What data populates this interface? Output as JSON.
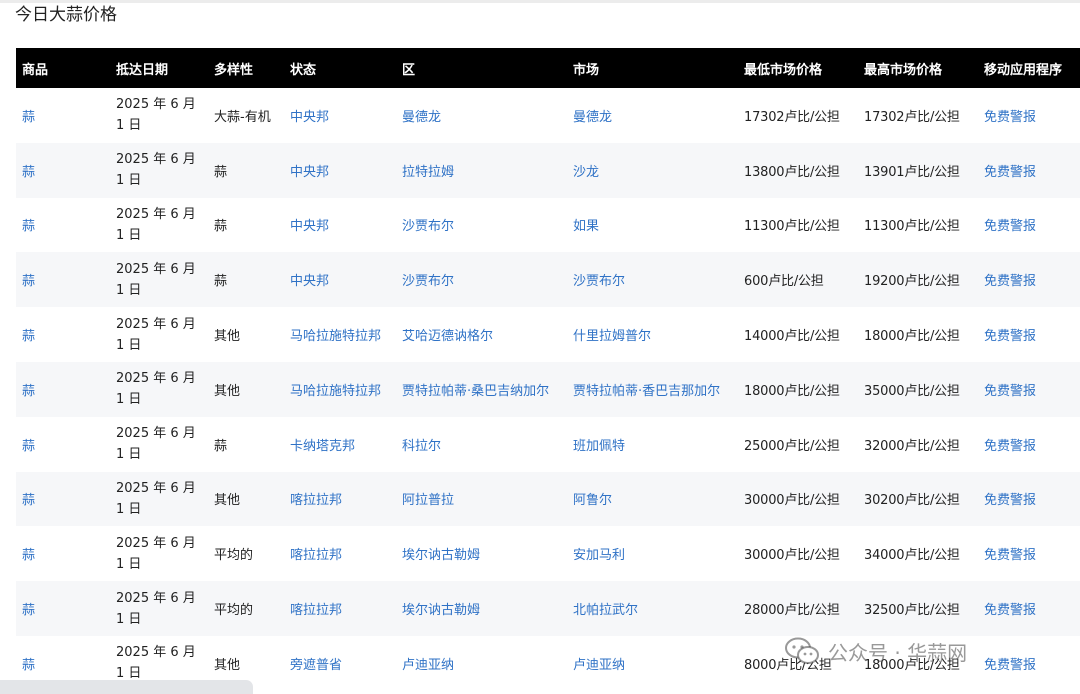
{
  "page": {
    "title": "今日大蒜价格"
  },
  "table": {
    "headers": [
      "商品",
      "抵达日期",
      "多样性",
      "状态",
      "区",
      "市场",
      "最低市场价格",
      "最高市场价格",
      "移动应用程序"
    ],
    "rows": [
      {
        "commodity": "蒜",
        "date": "2025 年 6 月 1 日",
        "variety": "大蒜-有机",
        "state": "中央邦",
        "district": "曼德龙",
        "market": "曼德龙",
        "min_price": "17302卢比/公担",
        "max_price": "17302卢比/公担",
        "app": "免费警报"
      },
      {
        "commodity": "蒜",
        "date": "2025 年 6 月 1 日",
        "variety": "蒜",
        "state": "中央邦",
        "district": "拉特拉姆",
        "market": "沙龙",
        "min_price": "13800卢比/公担",
        "max_price": "13901卢比/公担",
        "app": "免费警报"
      },
      {
        "commodity": "蒜",
        "date": "2025 年 6 月 1 日",
        "variety": "蒜",
        "state": "中央邦",
        "district": "沙贾布尔",
        "market": "如果",
        "min_price": "11300卢比/公担",
        "max_price": "11300卢比/公担",
        "app": "免费警报"
      },
      {
        "commodity": "蒜",
        "date": "2025 年 6 月 1 日",
        "variety": "蒜",
        "state": "中央邦",
        "district": "沙贾布尔",
        "market": "沙贾布尔",
        "min_price": "600卢比/公担",
        "max_price": "19200卢比/公担",
        "app": "免费警报"
      },
      {
        "commodity": "蒜",
        "date": "2025 年 6 月 1 日",
        "variety": "其他",
        "state": "马哈拉施特拉邦",
        "district": "艾哈迈德讷格尔",
        "market": "什里拉姆普尔",
        "min_price": "14000卢比/公担",
        "max_price": "18000卢比/公担",
        "app": "免费警报"
      },
      {
        "commodity": "蒜",
        "date": "2025 年 6 月 1 日",
        "variety": "其他",
        "state": "马哈拉施特拉邦",
        "district": "贾特拉帕蒂·桑巴吉纳加尔",
        "market": "贾特拉帕蒂·香巴吉那加尔",
        "min_price": "18000卢比/公担",
        "max_price": "35000卢比/公担",
        "app": "免费警报"
      },
      {
        "commodity": "蒜",
        "date": "2025 年 6 月 1 日",
        "variety": "蒜",
        "state": "卡纳塔克邦",
        "district": "科拉尔",
        "market": "班加佩特",
        "min_price": "25000卢比/公担",
        "max_price": "32000卢比/公担",
        "app": "免费警报"
      },
      {
        "commodity": "蒜",
        "date": "2025 年 6 月 1 日",
        "variety": "其他",
        "state": "喀拉拉邦",
        "district": "阿拉普拉",
        "market": "阿鲁尔",
        "min_price": "30000卢比/公担",
        "max_price": "30200卢比/公担",
        "app": "免费警报"
      },
      {
        "commodity": "蒜",
        "date": "2025 年 6 月 1 日",
        "variety": "平均的",
        "state": "喀拉拉邦",
        "district": "埃尔讷古勒姆",
        "market": "安加马利",
        "min_price": "30000卢比/公担",
        "max_price": "34000卢比/公担",
        "app": "免费警报"
      },
      {
        "commodity": "蒜",
        "date": "2025 年 6 月 1 日",
        "variety": "平均的",
        "state": "喀拉拉邦",
        "district": "埃尔讷古勒姆",
        "market": "北帕拉武尔",
        "min_price": "28000卢比/公担",
        "max_price": "32500卢比/公担",
        "app": "免费警报"
      },
      {
        "commodity": "蒜",
        "date": "2025 年 6 月 1 日",
        "variety": "其他",
        "state": "旁遮普省",
        "district": "卢迪亚纳",
        "market": "卢迪亚纳",
        "min_price": "8000卢比/公担",
        "max_price": "18000卢比/公担",
        "app": "免费警报"
      }
    ]
  },
  "watermark": {
    "text": "公众号 · 华蒜网",
    "icon": "wechat-icon"
  },
  "colors": {
    "header_bg": "#000000",
    "link": "#2f72c6",
    "row_alt": "#f6f7f9"
  }
}
